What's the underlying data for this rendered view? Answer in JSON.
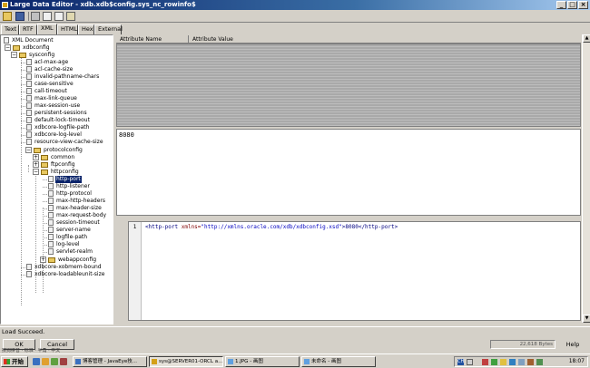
{
  "window": {
    "title": "Large Data Editor - xdb.xdb$config.sys_nc_rowinfo$"
  },
  "tabs": [
    {
      "label": "Text"
    },
    {
      "label": "RTF"
    },
    {
      "label": "XML"
    },
    {
      "label": "HTML"
    },
    {
      "label": "Hex"
    },
    {
      "label": "External"
    }
  ],
  "tree": {
    "root": "XML Document",
    "xdbconfig": "xdbconfig",
    "sysconfig": "sysconfig",
    "sys_items": [
      "acl-max-age",
      "acl-cache-size",
      "invalid-pathname-chars",
      "case-sensitive",
      "call-timeout",
      "max-link-queue",
      "max-session-use",
      "persistent-sessions",
      "default-lock-timeout",
      "xdbcore-logfile-path",
      "xdbcore-log-level",
      "resource-view-cache-size"
    ],
    "protocolconfig": "protocolconfig",
    "common": "common",
    "ftpconfig": "ftpconfig",
    "httpconfig": "httpconfig",
    "http_items": [
      "http-port",
      "http-listener",
      "http-protocol",
      "max-http-headers",
      "max-header-size",
      "max-request-body",
      "session-timeout",
      "server-name",
      "logfile-path",
      "log-level",
      "servlet-realm"
    ],
    "webappconfig": "webappconfig",
    "after_items": [
      "xdbcore-xobmem-bound",
      "xdbcore-loadableunit-size"
    ]
  },
  "attributes": {
    "col_name": "Attribute Name",
    "col_value": "Attribute Value"
  },
  "value_text": "8080",
  "code": {
    "line_no": "1",
    "open_tag": "<http-port",
    "attr_name": " xmlns=",
    "attr_value": "\"http://xmlns.oracle.com/xdb/xdbconfig.xsd\"",
    "rest": ">8080</http-port>"
  },
  "status": {
    "message": "Load Succeed.",
    "bytes": "22,618 Bytes",
    "help": "Help"
  },
  "buttons": {
    "ok": "OK",
    "cancel": "Cancel"
  },
  "ime_text": "搜狗拼音 · 标准 · 半角 · 中文",
  "taskbar": {
    "start": "开始",
    "apps": [
      "博客管理 - JavaEye技...",
      "sys@SERVER01-ORCL a...",
      "1.JPG - 画图",
      "未命名 - 画图"
    ],
    "clock": "18:07",
    "tray_ch": "CH"
  }
}
